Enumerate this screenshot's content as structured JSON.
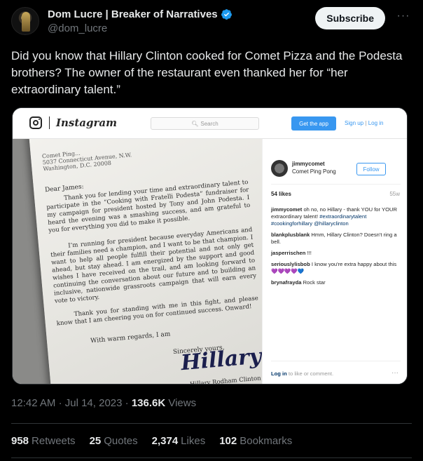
{
  "author": {
    "display_name": "Dom Lucre | Breaker of Narratives",
    "handle": "@dom_lucre",
    "verified_color": "#1d9bf0"
  },
  "actions": {
    "subscribe_label": "Subscribe",
    "more_icon": "more-horizontal-icon"
  },
  "tweet": {
    "text": "Did you know that Hillary Clinton cooked for Comet Pizza and the Podesta brothers? The owner of the restaurant even thanked her for “her extraordinary talent.”"
  },
  "instagram": {
    "wordmark": "Instagram",
    "search_placeholder": "Search",
    "get_app_label": "Get the app",
    "signup_label": "Sign up",
    "login_label": "Log in",
    "username": "jimmycomet",
    "location": "Comet Ping Pong",
    "follow_label": "Follow",
    "likes": "54 likes",
    "age": "55w",
    "comments": [
      {
        "user": "jimmycomet",
        "text": "oh no, no Hillary - thank YOU for YOUR extraordinary talent!",
        "tags": "#extraordinarytalent #cookingforhillary @hillaryclinton"
      },
      {
        "user": "blankplusblank",
        "text": "Hmm, Hillary Clinton? Doesn't ring a bell.",
        "tags": ""
      },
      {
        "user": "jasperrischen",
        "text": "!!!",
        "tags": ""
      },
      {
        "user": "seriouslylisbob",
        "text": "I know you're extra happy about this 💜💜💜💜💙",
        "tags": ""
      },
      {
        "user": "brynafrayda",
        "text": "Rock star",
        "tags": ""
      }
    ],
    "login_prompt_link": "Log in",
    "login_prompt_rest": "to like or comment.",
    "more_dots": "···"
  },
  "letter": {
    "address": [
      "Comet Ping...",
      "5037 Connecticut Avenue, N.W.",
      "Washington, D.C. 20008"
    ],
    "salutation": "Dear James:",
    "para1": "Thank you for lending your time and extraordinary talent to participate in the “Cooking with Fratelli Podesta” fundraiser for my campaign for president hosted by Tony and John Podesta. I heard the evening was a smashing success, and am grateful to you for everything you did to make it possible.",
    "para2": "I’m running for president because everyday Americans and their families need a champion, and I want to be that champion. I want to help all people fulfill their potential and not only get ahead, but stay ahead. I am energized by the support and good wishes I have received on the trail, and am looking forward to continuing the conversation about our future and to building an inclusive, nationwide grassroots campaign that will earn every vote to victory.",
    "para3": "Thank you for standing with me in this fight, and please know that I am cheering you on for continued success. Onward!",
    "closing": "With warm regards, I am",
    "yours": "Sincerely yours,",
    "signature": "Hillary",
    "typed_name": "Hillary Rodham Clinton"
  },
  "meta": {
    "time": "12:42 AM",
    "date": "Jul 14, 2023",
    "views_count": "136.6K",
    "views_label": "Views"
  },
  "stats": {
    "retweets_count": "958",
    "retweets_label": "Retweets",
    "quotes_count": "25",
    "quotes_label": "Quotes",
    "likes_count": "2,374",
    "likes_label": "Likes",
    "bookmarks_count": "102",
    "bookmarks_label": "Bookmarks"
  }
}
